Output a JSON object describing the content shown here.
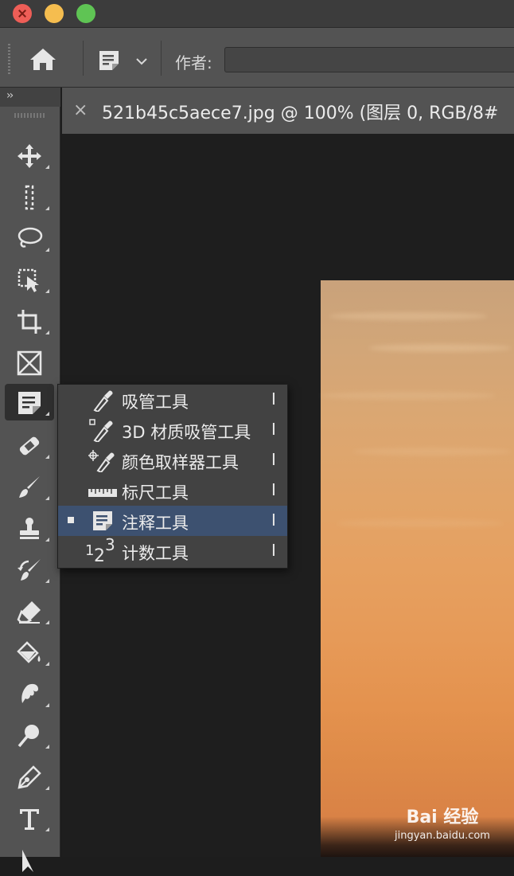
{
  "window": {
    "traffic_lights": {
      "close": "#ee5e57",
      "minimize": "#f5bd4f",
      "maximize": "#5fc454"
    }
  },
  "options_bar": {
    "home_icon": "home-icon",
    "preset_icon": "note-icon",
    "author_label": "作者:",
    "author_value": ""
  },
  "document_tab": {
    "title": "521b45c5aece7.jpg @ 100% (图层 0, RGB/8#",
    "close_glyph": "×"
  },
  "toolbar": {
    "expand_glyph": "››",
    "tools": [
      "move-tool",
      "marquee-tool",
      "lasso-tool",
      "object-selection-tool",
      "crop-tool",
      "frame-tool",
      "note-tool",
      "healing-brush-tool",
      "brush-tool",
      "clone-stamp-tool",
      "history-brush-tool",
      "eraser-tool",
      "paint-bucket-tool",
      "smudge-tool",
      "dodge-tool",
      "pen-tool",
      "type-tool",
      "path-selection-tool"
    ],
    "active_tool": "note-tool"
  },
  "flyout": {
    "items": [
      {
        "label": "吸管工具",
        "shortcut": "I",
        "icon": "eyedropper-icon",
        "selected": false
      },
      {
        "label": "3D 材质吸管工具",
        "shortcut": "I",
        "icon": "3d-eyedropper-icon",
        "selected": false
      },
      {
        "label": "颜色取样器工具",
        "shortcut": "I",
        "icon": "color-sampler-icon",
        "selected": false
      },
      {
        "label": "标尺工具",
        "shortcut": "I",
        "icon": "ruler-icon",
        "selected": false
      },
      {
        "label": "注释工具",
        "shortcut": "I",
        "icon": "note-icon",
        "selected": true
      },
      {
        "label": "计数工具",
        "shortcut": "I",
        "icon": "count-icon",
        "selected": false
      }
    ],
    "count_icon_text": "123",
    "selected_color": "#3d5170"
  },
  "watermark": {
    "logo": "Bai 经验",
    "url": "jingyan.baidu.com"
  }
}
